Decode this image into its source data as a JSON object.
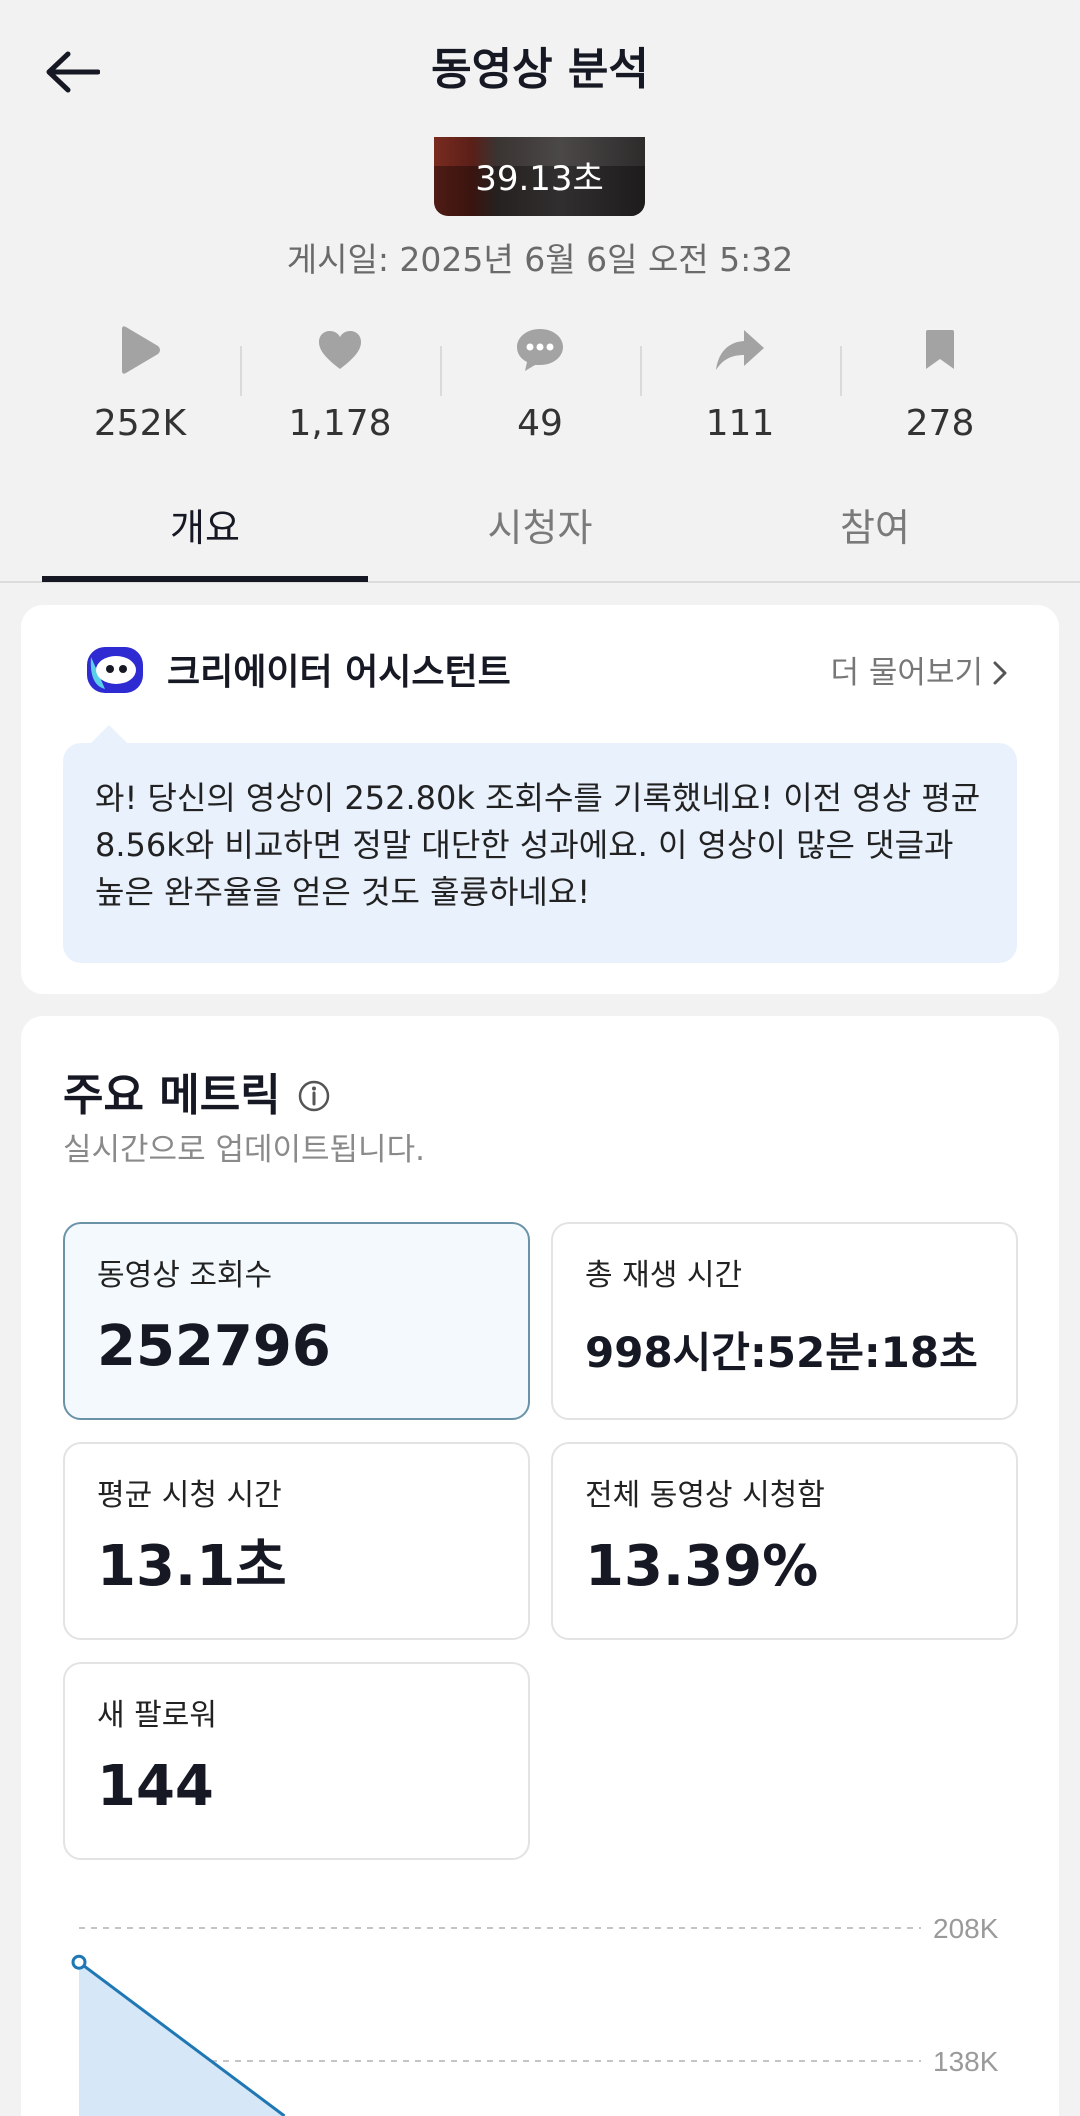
{
  "header": {
    "title": "동영상 분석"
  },
  "video": {
    "duration": "39.13초",
    "posted": "게시일: 2025년 6월 6일 오전 5:32"
  },
  "stats": [
    {
      "icon": "play-icon",
      "value": "252K"
    },
    {
      "icon": "heart-icon",
      "value": "1,178"
    },
    {
      "icon": "comment-icon",
      "value": "49"
    },
    {
      "icon": "share-icon",
      "value": "111"
    },
    {
      "icon": "bookmark-icon",
      "value": "278"
    }
  ],
  "tabs": [
    {
      "label": "개요",
      "active": true
    },
    {
      "label": "시청자",
      "active": false
    },
    {
      "label": "참여",
      "active": false
    }
  ],
  "assistant": {
    "title": "크리에이터 어시스턴트",
    "ask_more": "더 물어보기",
    "message": "와! 당신의 영상이 252.80k 조회수를 기록했네요! 이전 영상 평균 8.56k와 비교하면 정말 대단한 성과에요. 이 영상이 많은 댓글과 높은 완주율을 얻은 것도 훌륭하네요!"
  },
  "metrics": {
    "title": "주요 메트릭",
    "subtitle": "실시간으로 업데이트됩니다.",
    "items": [
      {
        "label": "동영상 조회수",
        "value": "252796",
        "selected": true
      },
      {
        "label": "총 재생 시간",
        "value": "998시간:52분:18초",
        "selected": false
      },
      {
        "label": "평균 시청 시간",
        "value": "13.1초",
        "selected": false
      },
      {
        "label": "전체 동영상 시청함",
        "value": "13.39%",
        "selected": false
      },
      {
        "label": "새 팔로워",
        "value": "144",
        "selected": false
      }
    ]
  },
  "chart_data": {
    "type": "area",
    "y_ticks": [
      "208K",
      "138K"
    ],
    "series": [
      {
        "values": [
          190000,
          138000
        ]
      }
    ],
    "colors": {
      "line": "#1f78b4",
      "fill": "#d6e7f7"
    }
  },
  "colors": {
    "accent": "#161823",
    "selected_border": "#6b93a8"
  }
}
